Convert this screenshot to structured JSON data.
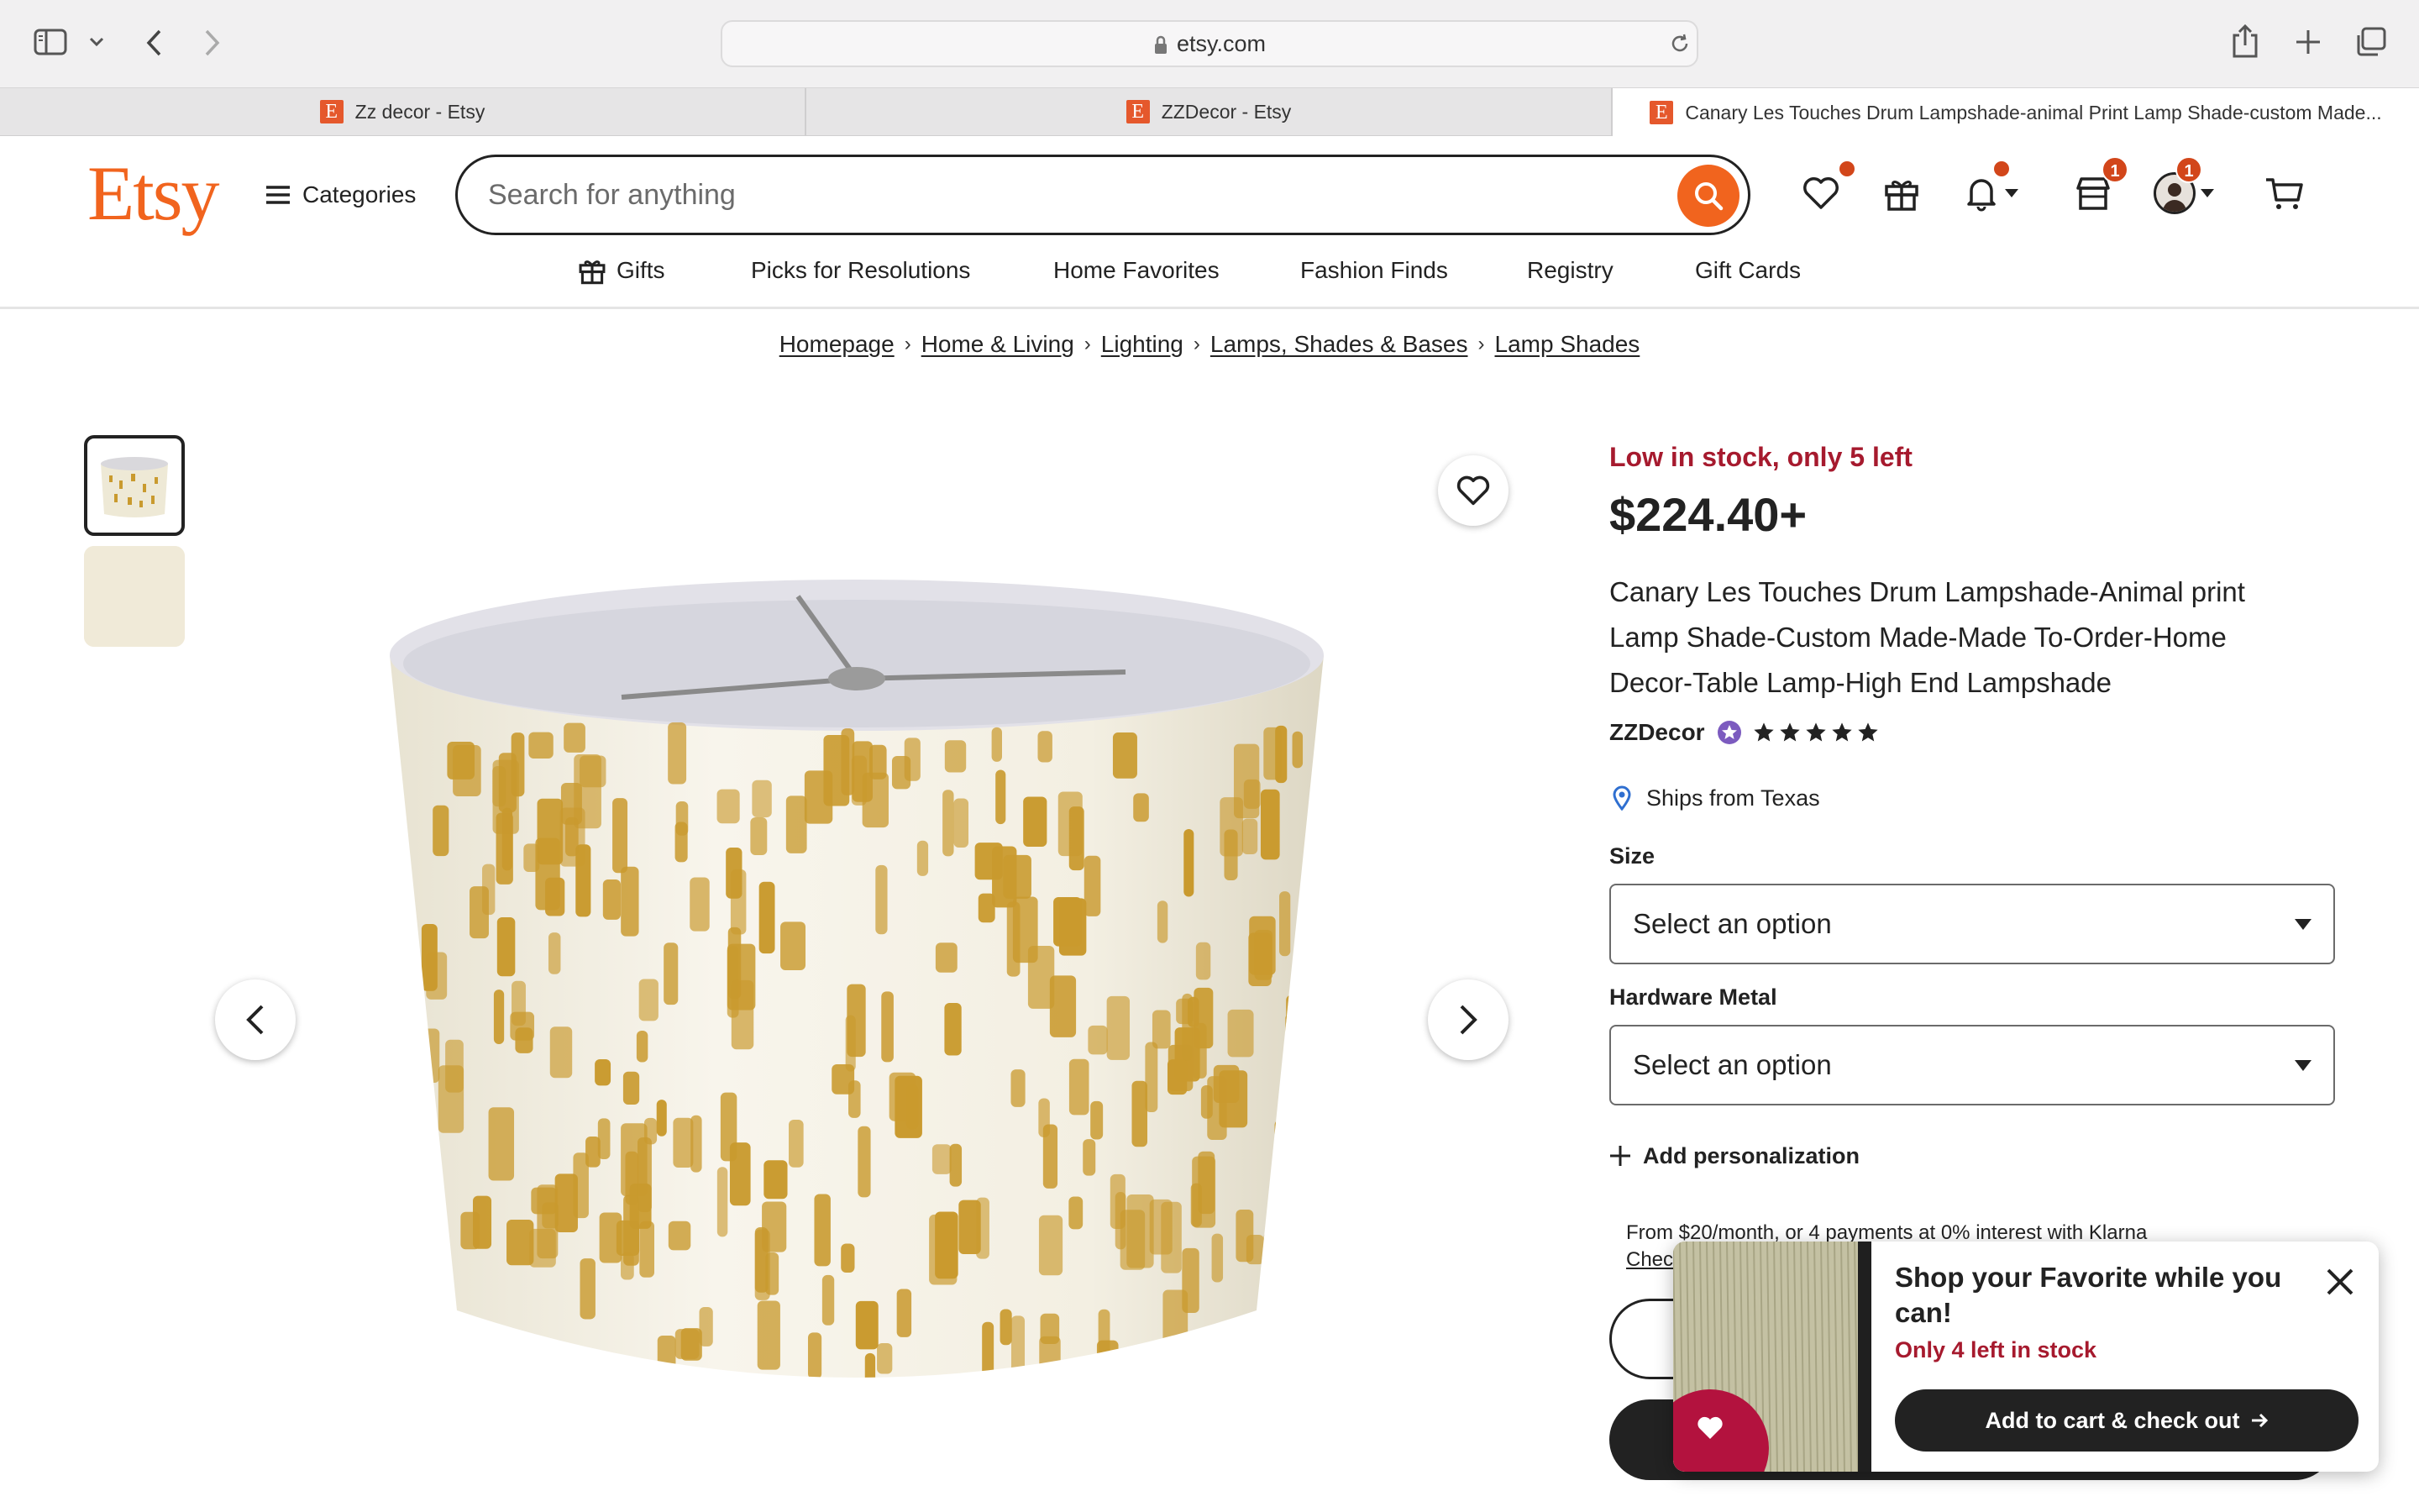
{
  "browser": {
    "url": "etsy.com",
    "tabs": [
      {
        "label": "Zz decor - Etsy",
        "active": false
      },
      {
        "label": "ZZDecor - Etsy",
        "active": false
      },
      {
        "label": "Canary Les Touches Drum Lampshade-animal Print Lamp Shade-custom Made...",
        "active": true
      }
    ],
    "favicon_letter": "E"
  },
  "header": {
    "logo": "Etsy",
    "categories_label": "Categories",
    "search_placeholder": "Search for anything",
    "shop_badge": "1",
    "avatar_badge": "1"
  },
  "nav": {
    "items": [
      "Gifts",
      "Picks for Resolutions",
      "Home Favorites",
      "Fashion Finds",
      "Registry",
      "Gift Cards"
    ]
  },
  "breadcrumb": [
    "Homepage",
    "Home & Living",
    "Lighting",
    "Lamps, Shades & Bases",
    "Lamp Shades"
  ],
  "product": {
    "stock_notice": "Low in stock, only 5 left",
    "price": "$224.40+",
    "title": "Canary Les Touches Drum Lampshade-Animal print Lamp Shade-Custom Made-Made To-Order-Home Decor-Table Lamp-High End Lampshade",
    "shop_name": "ZZDecor",
    "rating": 5,
    "ships_from": "Ships from Texas",
    "size_label": "Size",
    "size_value": "Select an option",
    "hardware_label": "Hardware Metal",
    "hardware_value": "Select an option",
    "add_personalization": "Add personalization",
    "klarna_line": "From $20/month, or 4 payments at 0% interest with Klarna",
    "klarna_link": "Chec"
  },
  "popup": {
    "title": "Shop your Favorite while you can!",
    "stock": "Only 4 left in stock",
    "button": "Add to cart & check out"
  },
  "colors": {
    "brand": "#f1641e",
    "stock_red": "#a61a2e",
    "badge": "#d2461a",
    "pattern_mustard": "#c99a2e"
  }
}
